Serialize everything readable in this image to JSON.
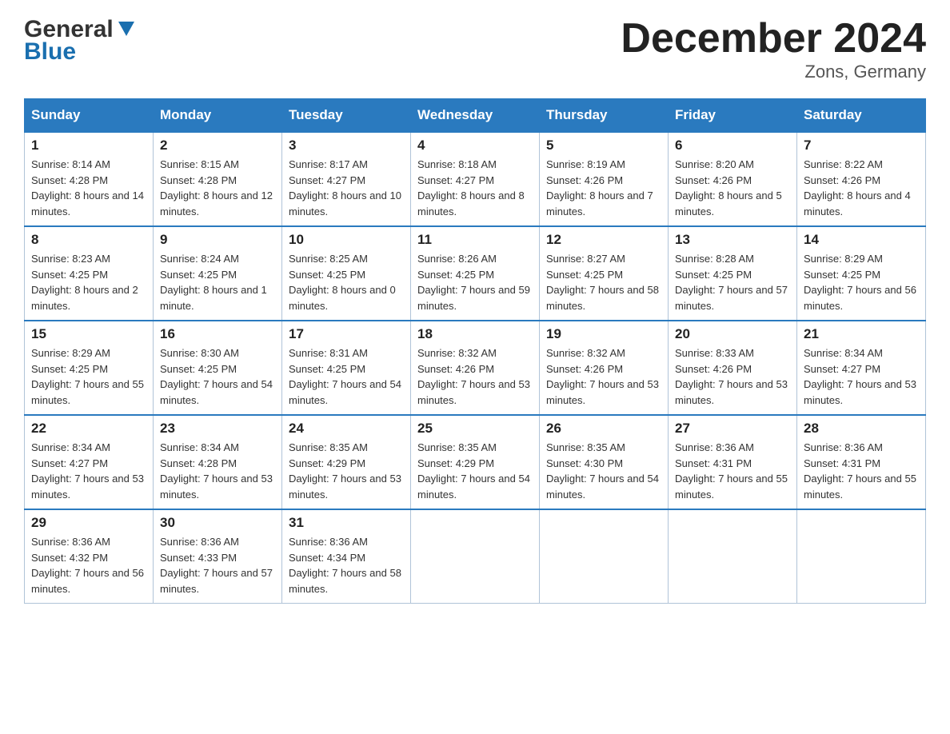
{
  "header": {
    "logo_general": "General",
    "logo_blue": "Blue",
    "title": "December 2024",
    "location": "Zons, Germany"
  },
  "weekdays": [
    "Sunday",
    "Monday",
    "Tuesday",
    "Wednesday",
    "Thursday",
    "Friday",
    "Saturday"
  ],
  "weeks": [
    [
      {
        "day": "1",
        "sunrise": "Sunrise: 8:14 AM",
        "sunset": "Sunset: 4:28 PM",
        "daylight": "Daylight: 8 hours and 14 minutes."
      },
      {
        "day": "2",
        "sunrise": "Sunrise: 8:15 AM",
        "sunset": "Sunset: 4:28 PM",
        "daylight": "Daylight: 8 hours and 12 minutes."
      },
      {
        "day": "3",
        "sunrise": "Sunrise: 8:17 AM",
        "sunset": "Sunset: 4:27 PM",
        "daylight": "Daylight: 8 hours and 10 minutes."
      },
      {
        "day": "4",
        "sunrise": "Sunrise: 8:18 AM",
        "sunset": "Sunset: 4:27 PM",
        "daylight": "Daylight: 8 hours and 8 minutes."
      },
      {
        "day": "5",
        "sunrise": "Sunrise: 8:19 AM",
        "sunset": "Sunset: 4:26 PM",
        "daylight": "Daylight: 8 hours and 7 minutes."
      },
      {
        "day": "6",
        "sunrise": "Sunrise: 8:20 AM",
        "sunset": "Sunset: 4:26 PM",
        "daylight": "Daylight: 8 hours and 5 minutes."
      },
      {
        "day": "7",
        "sunrise": "Sunrise: 8:22 AM",
        "sunset": "Sunset: 4:26 PM",
        "daylight": "Daylight: 8 hours and 4 minutes."
      }
    ],
    [
      {
        "day": "8",
        "sunrise": "Sunrise: 8:23 AM",
        "sunset": "Sunset: 4:25 PM",
        "daylight": "Daylight: 8 hours and 2 minutes."
      },
      {
        "day": "9",
        "sunrise": "Sunrise: 8:24 AM",
        "sunset": "Sunset: 4:25 PM",
        "daylight": "Daylight: 8 hours and 1 minute."
      },
      {
        "day": "10",
        "sunrise": "Sunrise: 8:25 AM",
        "sunset": "Sunset: 4:25 PM",
        "daylight": "Daylight: 8 hours and 0 minutes."
      },
      {
        "day": "11",
        "sunrise": "Sunrise: 8:26 AM",
        "sunset": "Sunset: 4:25 PM",
        "daylight": "Daylight: 7 hours and 59 minutes."
      },
      {
        "day": "12",
        "sunrise": "Sunrise: 8:27 AM",
        "sunset": "Sunset: 4:25 PM",
        "daylight": "Daylight: 7 hours and 58 minutes."
      },
      {
        "day": "13",
        "sunrise": "Sunrise: 8:28 AM",
        "sunset": "Sunset: 4:25 PM",
        "daylight": "Daylight: 7 hours and 57 minutes."
      },
      {
        "day": "14",
        "sunrise": "Sunrise: 8:29 AM",
        "sunset": "Sunset: 4:25 PM",
        "daylight": "Daylight: 7 hours and 56 minutes."
      }
    ],
    [
      {
        "day": "15",
        "sunrise": "Sunrise: 8:29 AM",
        "sunset": "Sunset: 4:25 PM",
        "daylight": "Daylight: 7 hours and 55 minutes."
      },
      {
        "day": "16",
        "sunrise": "Sunrise: 8:30 AM",
        "sunset": "Sunset: 4:25 PM",
        "daylight": "Daylight: 7 hours and 54 minutes."
      },
      {
        "day": "17",
        "sunrise": "Sunrise: 8:31 AM",
        "sunset": "Sunset: 4:25 PM",
        "daylight": "Daylight: 7 hours and 54 minutes."
      },
      {
        "day": "18",
        "sunrise": "Sunrise: 8:32 AM",
        "sunset": "Sunset: 4:26 PM",
        "daylight": "Daylight: 7 hours and 53 minutes."
      },
      {
        "day": "19",
        "sunrise": "Sunrise: 8:32 AM",
        "sunset": "Sunset: 4:26 PM",
        "daylight": "Daylight: 7 hours and 53 minutes."
      },
      {
        "day": "20",
        "sunrise": "Sunrise: 8:33 AM",
        "sunset": "Sunset: 4:26 PM",
        "daylight": "Daylight: 7 hours and 53 minutes."
      },
      {
        "day": "21",
        "sunrise": "Sunrise: 8:34 AM",
        "sunset": "Sunset: 4:27 PM",
        "daylight": "Daylight: 7 hours and 53 minutes."
      }
    ],
    [
      {
        "day": "22",
        "sunrise": "Sunrise: 8:34 AM",
        "sunset": "Sunset: 4:27 PM",
        "daylight": "Daylight: 7 hours and 53 minutes."
      },
      {
        "day": "23",
        "sunrise": "Sunrise: 8:34 AM",
        "sunset": "Sunset: 4:28 PM",
        "daylight": "Daylight: 7 hours and 53 minutes."
      },
      {
        "day": "24",
        "sunrise": "Sunrise: 8:35 AM",
        "sunset": "Sunset: 4:29 PM",
        "daylight": "Daylight: 7 hours and 53 minutes."
      },
      {
        "day": "25",
        "sunrise": "Sunrise: 8:35 AM",
        "sunset": "Sunset: 4:29 PM",
        "daylight": "Daylight: 7 hours and 54 minutes."
      },
      {
        "day": "26",
        "sunrise": "Sunrise: 8:35 AM",
        "sunset": "Sunset: 4:30 PM",
        "daylight": "Daylight: 7 hours and 54 minutes."
      },
      {
        "day": "27",
        "sunrise": "Sunrise: 8:36 AM",
        "sunset": "Sunset: 4:31 PM",
        "daylight": "Daylight: 7 hours and 55 minutes."
      },
      {
        "day": "28",
        "sunrise": "Sunrise: 8:36 AM",
        "sunset": "Sunset: 4:31 PM",
        "daylight": "Daylight: 7 hours and 55 minutes."
      }
    ],
    [
      {
        "day": "29",
        "sunrise": "Sunrise: 8:36 AM",
        "sunset": "Sunset: 4:32 PM",
        "daylight": "Daylight: 7 hours and 56 minutes."
      },
      {
        "day": "30",
        "sunrise": "Sunrise: 8:36 AM",
        "sunset": "Sunset: 4:33 PM",
        "daylight": "Daylight: 7 hours and 57 minutes."
      },
      {
        "day": "31",
        "sunrise": "Sunrise: 8:36 AM",
        "sunset": "Sunset: 4:34 PM",
        "daylight": "Daylight: 7 hours and 58 minutes."
      },
      null,
      null,
      null,
      null
    ]
  ]
}
